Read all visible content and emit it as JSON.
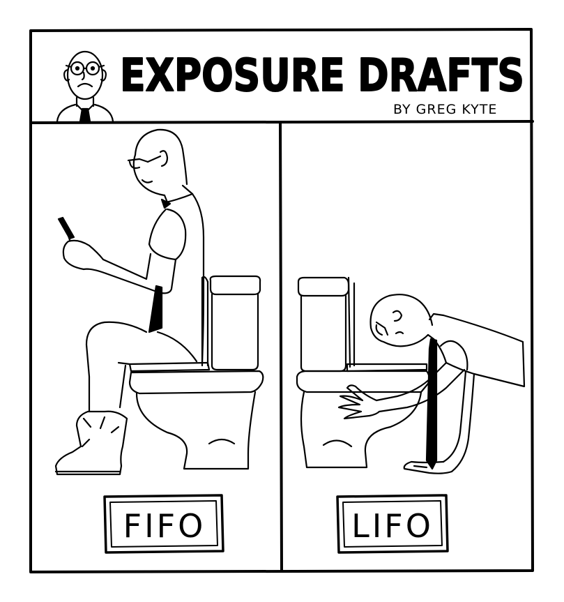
{
  "comic": {
    "title": "EXPOSURE DRAFTS",
    "byline": "BY GREG KYTE",
    "panels": [
      {
        "caption": "FIFO"
      },
      {
        "caption": "LIFO"
      }
    ]
  }
}
